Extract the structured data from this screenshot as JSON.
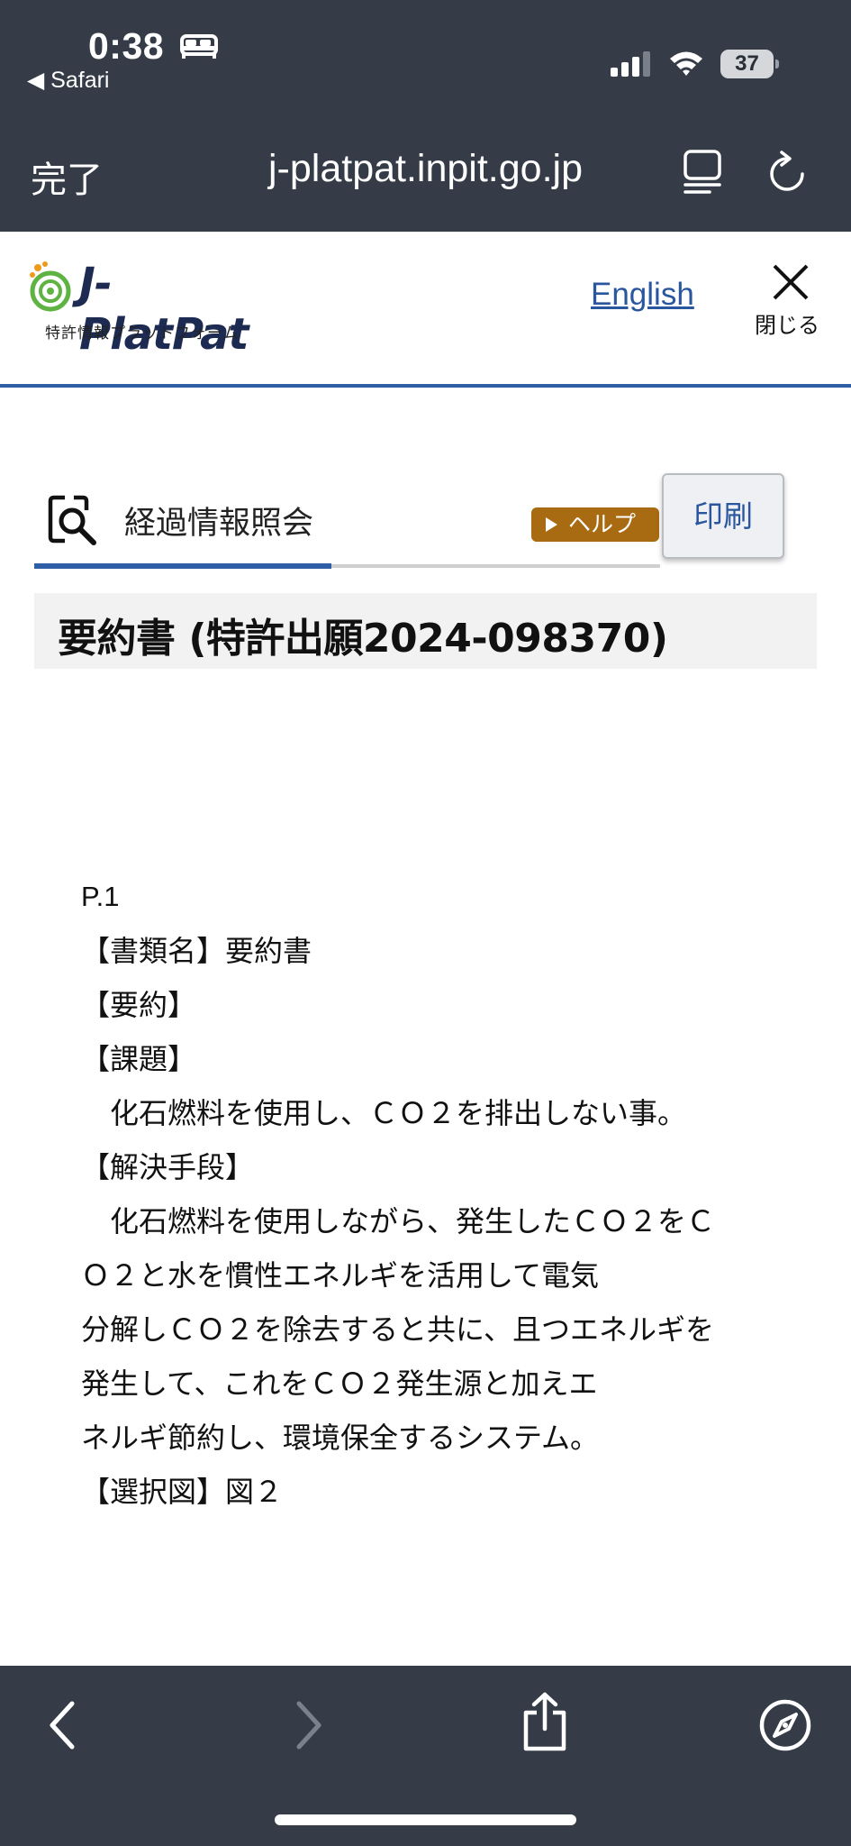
{
  "status_bar": {
    "time": "0:38",
    "back_app": "◀ Safari",
    "battery_level": "37"
  },
  "browser": {
    "done_label": "完了",
    "url": "j-platpat.inpit.go.jp"
  },
  "site_header": {
    "logo_name": "J-PlatPat",
    "logo_subtitle": "特許情報プラットフォーム",
    "english_link": "English",
    "close_label": "閉じる"
  },
  "title_bar": {
    "title": "経過情報照会",
    "help_label": "ヘルプ",
    "print_label": "印刷"
  },
  "document": {
    "heading": "要約書 (特許出願2024-098370)",
    "lines": [
      "P.1",
      "【書類名】要約書",
      "【要約】",
      "【課題】",
      "　化石燃料を使用し、ＣＯ２を排出しない事。",
      "【解決手段】",
      "　化石燃料を使用しながら、発生したＣＯ２をＣ",
      "Ｏ２と水を慣性エネルギを活用して電気",
      "分解しＣＯ２を除去すると共に、且つエネルギを",
      "発生して、これをＣＯ２発生源と加えエ",
      "ネルギ節約し、環境保全するシステム。",
      "【選択図】図２"
    ]
  },
  "colors": {
    "chrome_bg": "#353c48",
    "accent_blue": "#2f5da6",
    "help_brown": "#a86b12",
    "link_blue": "#2a56a0"
  },
  "icons": {
    "bed": "bed-icon",
    "signal": "cellular-signal-icon",
    "wifi": "wifi-icon",
    "reader": "reader-mode-icon",
    "reload": "reload-icon",
    "close": "close-icon",
    "search": "document-search-icon",
    "back": "chevron-left-icon",
    "forward": "chevron-right-icon",
    "share": "share-icon",
    "compass": "compass-icon"
  }
}
